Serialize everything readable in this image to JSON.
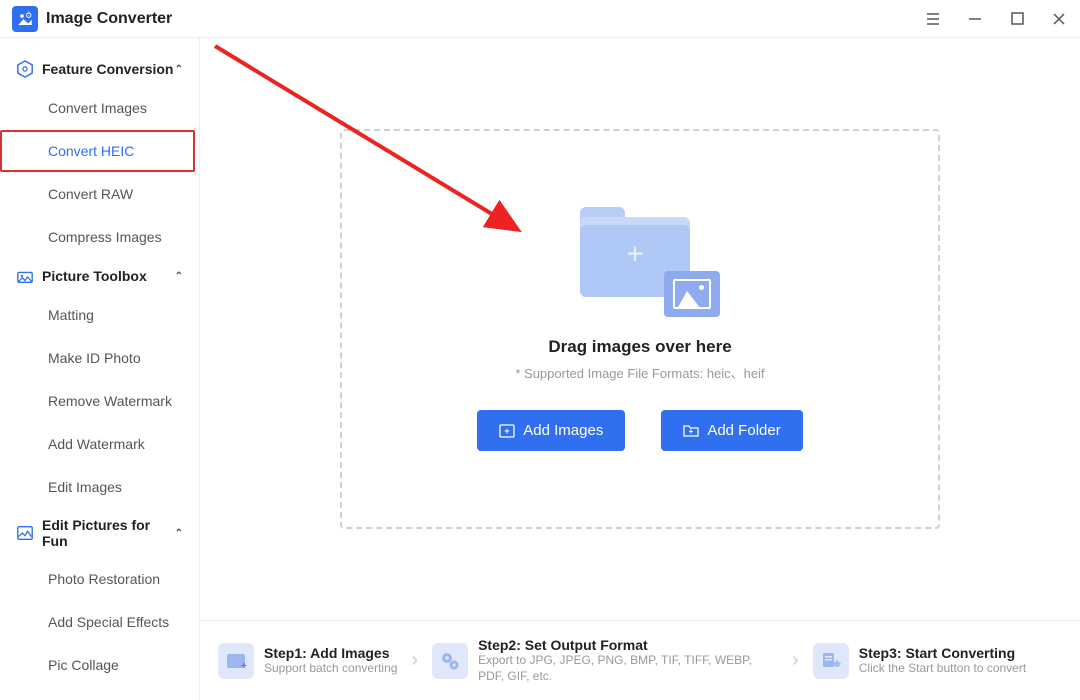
{
  "app": {
    "title": "Image Converter"
  },
  "sidebar": {
    "sections": [
      {
        "label": "Feature Conversion",
        "items": [
          {
            "label": "Convert Images"
          },
          {
            "label": "Convert HEIC"
          },
          {
            "label": "Convert RAW"
          },
          {
            "label": "Compress Images"
          }
        ]
      },
      {
        "label": "Picture Toolbox",
        "items": [
          {
            "label": "Matting"
          },
          {
            "label": "Make ID Photo"
          },
          {
            "label": "Remove Watermark"
          },
          {
            "label": "Add Watermark"
          },
          {
            "label": "Edit Images"
          }
        ]
      },
      {
        "label": "Edit Pictures for Fun",
        "items": [
          {
            "label": "Photo Restoration"
          },
          {
            "label": "Add Special Effects"
          },
          {
            "label": "Pic Collage"
          }
        ]
      }
    ]
  },
  "dropzone": {
    "title": "Drag images over here",
    "subtitle": "* Supported Image File Formats: heic、heif",
    "add_images": "Add Images",
    "add_folder": "Add Folder"
  },
  "steps": {
    "s1_title": "Step1:  Add Images",
    "s1_desc": "Support batch converting",
    "s2_title": "Step2:  Set Output Format",
    "s2_desc": "Export to JPG, JPEG, PNG, BMP, TIF, TIFF, WEBP, PDF, GIF, etc.",
    "s3_title": "Step3:  Start Converting",
    "s3_desc": "Click the Start button to convert"
  }
}
